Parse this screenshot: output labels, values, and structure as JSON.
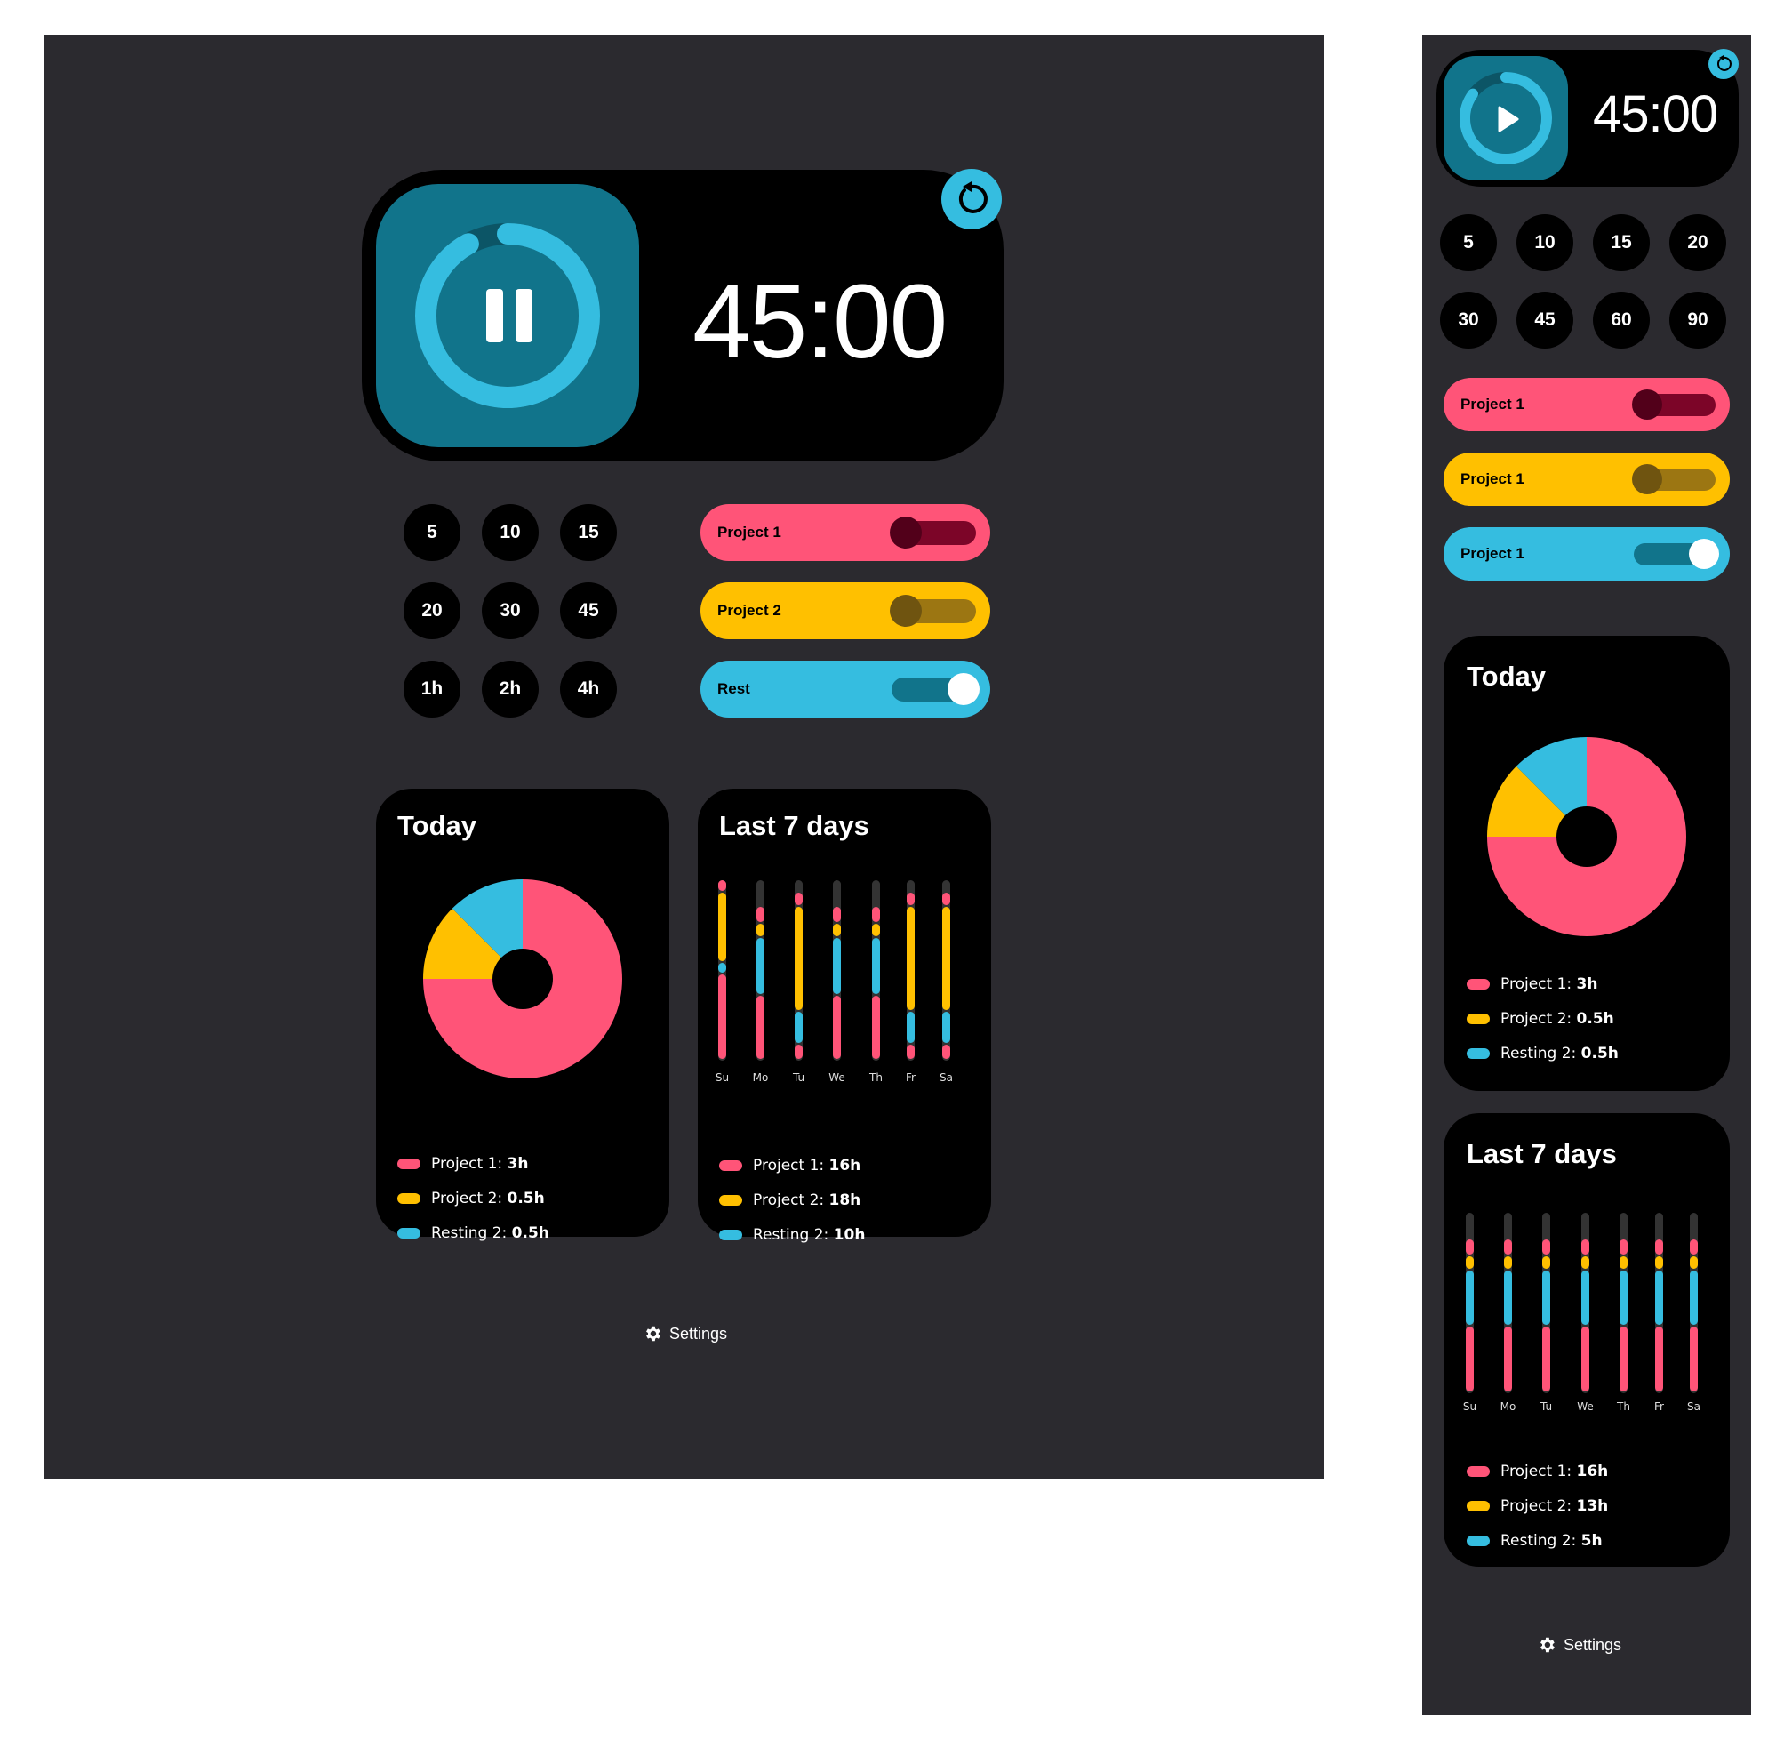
{
  "colors": {
    "panel": "#2b2a2f",
    "card": "#000000",
    "teal_tile": "#11748b",
    "cyan": "#35bde0",
    "pink": "#ff5478",
    "pink_dark_track": "#7c0528",
    "pink_knob": "#52001a",
    "yellow": "#ffc000",
    "yellow_track": "#9c7612",
    "yellow_knob": "#6f5410",
    "rest_track": "#11748b",
    "white": "#ffffff",
    "bar_bg": "#333333"
  },
  "desktop": {
    "timer": {
      "time": "45:00",
      "state": "running",
      "control_icon": "pause-icon",
      "reset_icon": "reset-icon",
      "progress": 0.92
    },
    "durations": [
      "5",
      "10",
      "15",
      "20",
      "30",
      "45",
      "1h",
      "2h",
      "4h"
    ],
    "projects": [
      {
        "label": "Project 1",
        "color": "pink",
        "on": false
      },
      {
        "label": "Project 2",
        "color": "yellow",
        "on": false
      },
      {
        "label": "Rest",
        "color": "cyan",
        "on": true
      }
    ],
    "today": {
      "title": "Today",
      "legend": [
        {
          "name": "Project 1: ",
          "value": "3h",
          "color": "#ff5478"
        },
        {
          "name": "Project 2: ",
          "value": "0.5h",
          "color": "#ffc000"
        },
        {
          "name": "Resting 2: ",
          "value": "0.5h",
          "color": "#35bde0"
        }
      ]
    },
    "week": {
      "title": "Last 7 days",
      "legend": [
        {
          "name": "Project 1: ",
          "value": "16h",
          "color": "#ff5478"
        },
        {
          "name": "Project 2: ",
          "value": "18h",
          "color": "#ffc000"
        },
        {
          "name": "Resting 2: ",
          "value": "10h",
          "color": "#35bde0"
        }
      ]
    },
    "settings_label": "Settings"
  },
  "mobile": {
    "timer": {
      "time": "45:00",
      "state": "paused",
      "control_icon": "play-icon",
      "reset_icon": "reset-icon",
      "progress": 0.85
    },
    "durations": [
      "5",
      "10",
      "15",
      "20",
      "30",
      "45",
      "60",
      "90"
    ],
    "projects": [
      {
        "label": "Project 1",
        "color": "pink",
        "on": false
      },
      {
        "label": "Project 1",
        "color": "yellow",
        "on": false
      },
      {
        "label": "Project 1",
        "color": "cyan",
        "on": true
      }
    ],
    "today": {
      "title": "Today",
      "legend": [
        {
          "name": "Project 1: ",
          "value": "3h",
          "color": "#ff5478"
        },
        {
          "name": "Project 2: ",
          "value": "0.5h",
          "color": "#ffc000"
        },
        {
          "name": "Resting 2: ",
          "value": "0.5h",
          "color": "#35bde0"
        }
      ]
    },
    "week": {
      "title": "Last 7 days",
      "legend": [
        {
          "name": "Project 1: ",
          "value": "16h",
          "color": "#ff5478"
        },
        {
          "name": "Project 2: ",
          "value": "13h",
          "color": "#ffc000"
        },
        {
          "name": "Resting 2: ",
          "value": "5h",
          "color": "#35bde0"
        }
      ]
    },
    "settings_label": "Settings"
  },
  "chart_data": [
    {
      "type": "pie",
      "title": "Today",
      "categories": [
        "Project 1",
        "Project 2",
        "Resting 2"
      ],
      "values": [
        3,
        0.5,
        0.5
      ],
      "colors": [
        "#ff5478",
        "#ffc000",
        "#35bde0"
      ],
      "hole": true
    },
    {
      "type": "bar",
      "title": "Last 7 days",
      "stacked": true,
      "orientation": "vertical",
      "categories": [
        "Su",
        "Mo",
        "Tu",
        "We",
        "Th",
        "Fr",
        "Sa"
      ],
      "series": [
        {
          "name": "Project 1",
          "color": "#ff5478"
        },
        {
          "name": "Project 2",
          "color": "#ffc000"
        },
        {
          "name": "Resting 2",
          "color": "#35bde0"
        }
      ],
      "desktop_segments": [
        [
          [
            "#ff5478",
            0.0,
            0.48
          ],
          [
            "#35bde0",
            0.48,
            0.54
          ],
          [
            "#ffc000",
            0.54,
            0.93
          ],
          [
            "#ff5478",
            0.93,
            1.0
          ]
        ],
        [
          [
            "#ff5478",
            0.0,
            0.36
          ],
          [
            "#35bde0",
            0.36,
            0.68
          ],
          [
            "#ffc000",
            0.68,
            0.76
          ],
          [
            "#ff5478",
            0.76,
            0.85
          ]
        ],
        [
          [
            "#ff5478",
            0.0,
            0.09
          ],
          [
            "#35bde0",
            0.09,
            0.27
          ],
          [
            "#ffc000",
            0.27,
            0.85
          ],
          [
            "#ff5478",
            0.85,
            0.93
          ]
        ],
        [
          [
            "#ff5478",
            0.0,
            0.36
          ],
          [
            "#35bde0",
            0.36,
            0.68
          ],
          [
            "#ffc000",
            0.68,
            0.76
          ],
          [
            "#ff5478",
            0.76,
            0.85
          ]
        ],
        [
          [
            "#ff5478",
            0.0,
            0.36
          ],
          [
            "#35bde0",
            0.36,
            0.68
          ],
          [
            "#ffc000",
            0.68,
            0.76
          ],
          [
            "#ff5478",
            0.76,
            0.85
          ]
        ],
        [
          [
            "#ff5478",
            0.0,
            0.09
          ],
          [
            "#35bde0",
            0.09,
            0.27
          ],
          [
            "#ffc000",
            0.27,
            0.85
          ],
          [
            "#ff5478",
            0.85,
            0.93
          ]
        ],
        [
          [
            "#ff5478",
            0.0,
            0.09
          ],
          [
            "#35bde0",
            0.09,
            0.27
          ],
          [
            "#ffc000",
            0.27,
            0.85
          ],
          [
            "#ff5478",
            0.85,
            0.93
          ]
        ]
      ],
      "mobile_segments": [
        [
          [
            "#ff5478",
            0.0,
            0.37
          ],
          [
            "#35bde0",
            0.37,
            0.68
          ],
          [
            "#ffc000",
            0.68,
            0.76
          ],
          [
            "#ff5478",
            0.76,
            0.85
          ]
        ],
        [
          [
            "#ff5478",
            0.0,
            0.37
          ],
          [
            "#35bde0",
            0.37,
            0.68
          ],
          [
            "#ffc000",
            0.68,
            0.76
          ],
          [
            "#ff5478",
            0.76,
            0.85
          ]
        ],
        [
          [
            "#ff5478",
            0.0,
            0.37
          ],
          [
            "#35bde0",
            0.37,
            0.68
          ],
          [
            "#ffc000",
            0.68,
            0.76
          ],
          [
            "#ff5478",
            0.76,
            0.85
          ]
        ],
        [
          [
            "#ff5478",
            0.0,
            0.37
          ],
          [
            "#35bde0",
            0.37,
            0.68
          ],
          [
            "#ffc000",
            0.68,
            0.76
          ],
          [
            "#ff5478",
            0.76,
            0.85
          ]
        ],
        [
          [
            "#ff5478",
            0.0,
            0.37
          ],
          [
            "#35bde0",
            0.37,
            0.68
          ],
          [
            "#ffc000",
            0.68,
            0.76
          ],
          [
            "#ff5478",
            0.76,
            0.85
          ]
        ],
        [
          [
            "#ff5478",
            0.0,
            0.37
          ],
          [
            "#35bde0",
            0.37,
            0.68
          ],
          [
            "#ffc000",
            0.68,
            0.76
          ],
          [
            "#ff5478",
            0.76,
            0.85
          ]
        ],
        [
          [
            "#ff5478",
            0.0,
            0.37
          ],
          [
            "#35bde0",
            0.37,
            0.68
          ],
          [
            "#ffc000",
            0.68,
            0.76
          ],
          [
            "#ff5478",
            0.76,
            0.85
          ]
        ]
      ]
    }
  ]
}
